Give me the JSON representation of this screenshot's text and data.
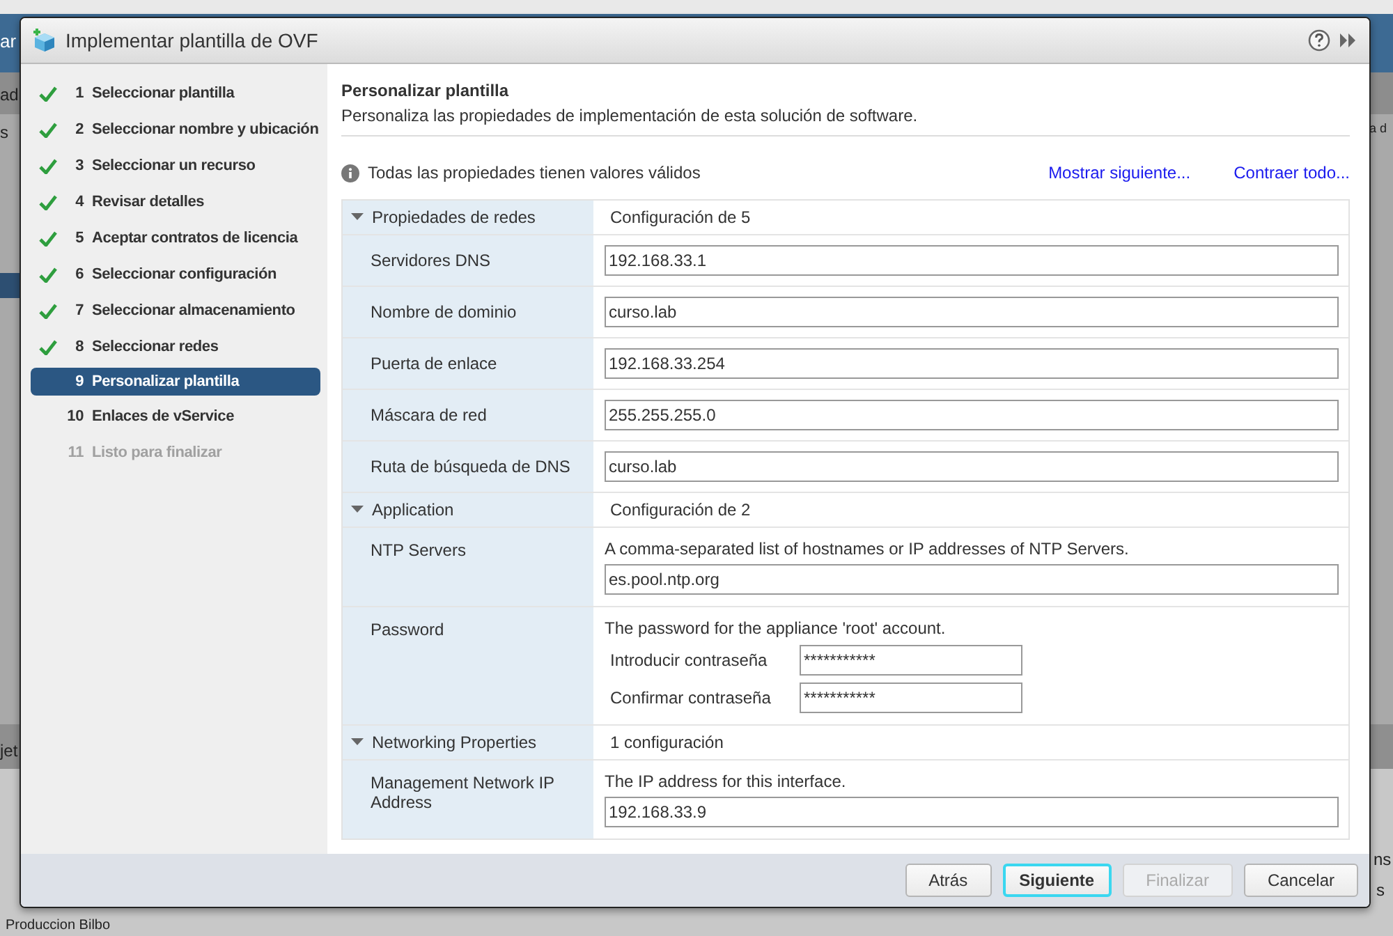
{
  "background": {
    "fragments": [
      "ar",
      "ad",
      "s",
      "jet",
      "Produccion Bilbo",
      "a d",
      "ns",
      "s"
    ]
  },
  "dialog": {
    "title": "Implementar plantilla de OVF",
    "steps": [
      {
        "number": "1",
        "label": "Seleccionar plantilla",
        "completed": true,
        "selected": false,
        "disabled": false
      },
      {
        "number": "2",
        "label": "Seleccionar nombre y ubicación",
        "completed": true,
        "selected": false,
        "disabled": false
      },
      {
        "number": "3",
        "label": "Seleccionar un recurso",
        "completed": true,
        "selected": false,
        "disabled": false
      },
      {
        "number": "4",
        "label": "Revisar detalles",
        "completed": true,
        "selected": false,
        "disabled": false
      },
      {
        "number": "5",
        "label": "Aceptar contratos de licencia",
        "completed": true,
        "selected": false,
        "disabled": false
      },
      {
        "number": "6",
        "label": "Seleccionar configuración",
        "completed": true,
        "selected": false,
        "disabled": false
      },
      {
        "number": "7",
        "label": "Seleccionar almacenamiento",
        "completed": true,
        "selected": false,
        "disabled": false
      },
      {
        "number": "8",
        "label": "Seleccionar redes",
        "completed": true,
        "selected": false,
        "disabled": false
      },
      {
        "number": "9",
        "label": "Personalizar plantilla",
        "completed": false,
        "selected": true,
        "disabled": false
      },
      {
        "number": "10",
        "label": "Enlaces de vService",
        "completed": false,
        "selected": false,
        "disabled": false
      },
      {
        "number": "11",
        "label": "Listo para finalizar",
        "completed": false,
        "selected": false,
        "disabled": true
      }
    ],
    "page": {
      "heading": "Personalizar plantilla",
      "description": "Personaliza las propiedades de implementación de esta solución de software.",
      "status": "Todas las propiedades tienen valores válidos",
      "links": [
        "Mostrar siguiente...",
        "Contraer todo..."
      ],
      "sections": [
        {
          "title": "Propiedades de redes",
          "summary": "Configuración de 5",
          "expanded": true,
          "fields": [
            {
              "kind": "text",
              "label": "Servidores DNS",
              "value": "192.168.33.1"
            },
            {
              "kind": "text",
              "label": "Nombre de dominio",
              "value": "curso.lab"
            },
            {
              "kind": "text",
              "label": "Puerta de enlace",
              "value": "192.168.33.254"
            },
            {
              "kind": "text",
              "label": "Máscara de red",
              "value": "255.255.255.0"
            },
            {
              "kind": "text",
              "label": "Ruta de búsqueda de DNS",
              "value": "curso.lab"
            }
          ]
        },
        {
          "title": "Application",
          "summary": "Configuración de 2",
          "expanded": true,
          "fields": [
            {
              "kind": "text",
              "label": "NTP Servers",
              "description": "A comma-separated list of hostnames or IP addresses of NTP Servers.",
              "value": "es.pool.ntp.org"
            },
            {
              "kind": "password",
              "label": "Password",
              "description": "The password for the appliance 'root' account.",
              "entries": [
                {
                  "label": "Introducir contraseña",
                  "value": "***********"
                },
                {
                  "label": "Confirmar contraseña",
                  "value": "***********"
                }
              ]
            }
          ]
        },
        {
          "title": "Networking Properties",
          "summary": "1 configuración",
          "expanded": true,
          "fields": [
            {
              "kind": "text",
              "label": "Management Network IP Address",
              "description": "The IP address for this interface.",
              "value": "192.168.33.9"
            }
          ]
        }
      ]
    },
    "buttons": [
      {
        "label": "Atrás",
        "focused": false,
        "disabled": false
      },
      {
        "label": "Siguiente",
        "focused": true,
        "disabled": false
      },
      {
        "label": "Finalizar",
        "focused": false,
        "disabled": true
      },
      {
        "label": "Cancelar",
        "focused": false,
        "disabled": false
      }
    ]
  }
}
